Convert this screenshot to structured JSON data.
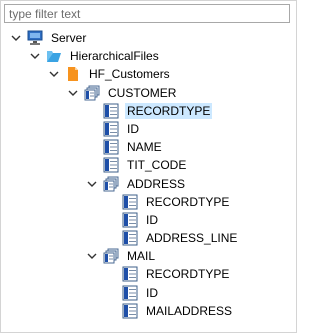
{
  "filter": {
    "placeholder": "type filter text",
    "value": ""
  },
  "tree": {
    "server": "Server",
    "hierarchical_files": "HierarchicalFiles",
    "hf_customers": "HF_Customers",
    "customer": {
      "label": "CUSTOMER",
      "fields": [
        "RECORDTYPE",
        "ID",
        "NAME",
        "TIT_CODE"
      ],
      "selected_field": "RECORDTYPE"
    },
    "address": {
      "label": "ADDRESS",
      "fields": [
        "RECORDTYPE",
        "ID",
        "ADDRESS_LINE"
      ]
    },
    "mail": {
      "label": "MAIL",
      "fields": [
        "RECORDTYPE",
        "ID",
        "MAILADDRESS"
      ]
    }
  },
  "colors": {
    "selection": "#cce8ff",
    "folder": "#3aa3e3",
    "file": "#f7931e",
    "field": "#1e4fa8"
  }
}
